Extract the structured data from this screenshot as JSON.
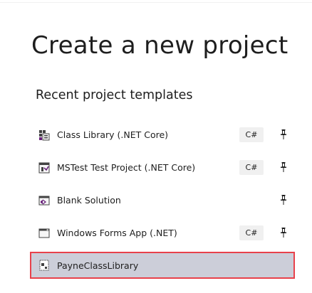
{
  "page": {
    "title": "Create a new project",
    "recent_section_title": "Recent project templates"
  },
  "templates": [
    {
      "name": "Class Library (.NET Core)",
      "language": "C#",
      "icon": "class-library-icon",
      "pinned_icon": "pin-icon"
    },
    {
      "name": "MSTest Test Project (.NET Core)",
      "language": "C#",
      "icon": "test-project-icon",
      "pinned_icon": "pin-icon"
    },
    {
      "name": "Blank Solution",
      "language": "",
      "icon": "blank-solution-icon",
      "pinned_icon": "pin-icon"
    },
    {
      "name": "Windows Forms App (.NET)",
      "language": "C#",
      "icon": "windows-forms-icon",
      "pinned_icon": "pin-icon"
    },
    {
      "name": "PayneClassLibrary",
      "language": "",
      "icon": "custom-template-icon",
      "selected": true
    }
  ],
  "colors": {
    "selected_background": "#ccced9",
    "highlight_border": "#e8414b",
    "badge_background": "#f0f0f0",
    "vs_purple": "#68217a"
  }
}
